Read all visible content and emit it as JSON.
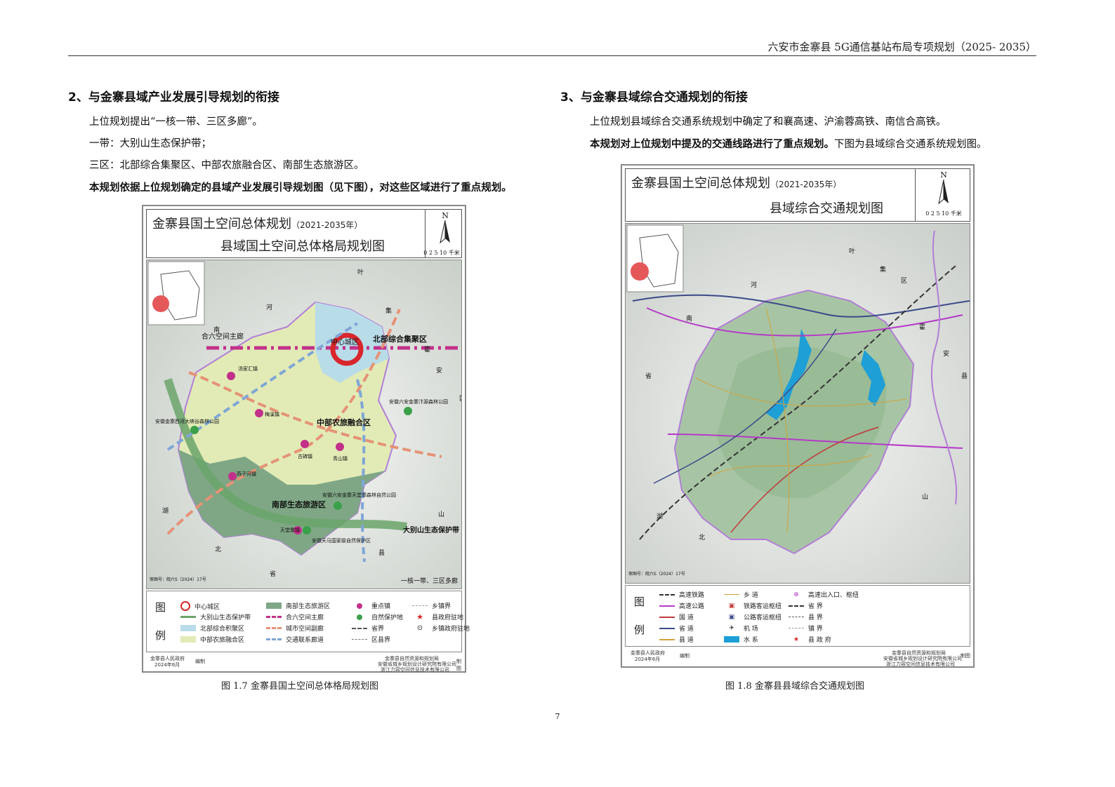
{
  "header": {
    "title": "六安市金寨县 5G通信基站布局专项规划（2025- 2035）"
  },
  "left": {
    "heading": "2、与金寨县域产业发展引导规划的衔接",
    "paras": [
      "上位规划提出“一核一带、三区多廊”。",
      "一带：大别山生态保护带；",
      "三区：北部综合集聚区、中部农旅融合区、南部生态旅游区。",
      "本规划依据上位规划确定的县域产业发展引导规划图（见下图），对这些区域进行了重点规划。"
    ],
    "map": {
      "title1": "金寨县国土空间总体规划",
      "title1_years": "（2021-2035年）",
      "title2": "县域国土空间总体格局规划图",
      "scale": "0 2 5    10",
      "scale_unit": "千米",
      "north": "N",
      "labels": {
        "corridor": "合六空间主廊",
        "center": "中心城区",
        "north_zone": "北部综合集聚区",
        "mid_zone": "中部农旅融合区",
        "south_zone": "南部生态旅游区",
        "belt": "大别山生态保护带",
        "slogan": "一核一带、三区多廊",
        "park1": "安徽金寨西河大峡谷森林公园",
        "park2": "安徽六安金寨汴源森林公园",
        "park3": "安徽六安金寨天堂寨森林自然公园",
        "park4": "安徽天马国家级自然保护区",
        "town1": "汤家汇镇",
        "town2": "梅溪镇",
        "town3": "古碑镇",
        "town4": "青山镇",
        "town5": "燕子河镇",
        "town6": "天堂寨镇",
        "chars": [
          "叶",
          "集",
          "河",
          "南",
          "霍",
          "安",
          "区",
          "湖",
          "北",
          "省",
          "县",
          "山"
        ]
      },
      "legend_key": [
        "图",
        "例"
      ],
      "legend": [
        "中心城区",
        "大别山生态保护带",
        "北部综合积聚区",
        "中部农旅融合区",
        "南部生态旅游区",
        "合六空间主廊",
        "城市空间副廊",
        "交通联系廊道",
        "重点镇",
        "自然保护地",
        "省界",
        "区县界",
        "乡镇界",
        "县政府驻地",
        "乡镇政府驻地"
      ],
      "footer_left": "金寨县人民政府",
      "footer_date": "2024年6月",
      "footer_edit": "编制",
      "footer_org1": "金寨县自然资源和规划局",
      "footer_org2": "安徽省城乡规划设计研究院有限公司",
      "footer_org3": "浙江力容空间信息技术有限公司",
      "footer_draw": "制图",
      "review": "审图号：皖六S（2024）17号"
    },
    "caption": "图 1.7  金寨县国土空间总体格局规划图"
  },
  "right": {
    "heading": "3、与金寨县域综合交通规划的衔接",
    "paras": [
      "上位规划县域综合交通系统规划中确定了和襄高速、沪渝蓉高铁、南信合高铁。"
    ],
    "bold_part": "本规划对上位规划中提及的交通线路进行了重点规划。",
    "normal_part": "下图为县域综合交通系统规划图。",
    "map": {
      "title1": "金寨县国土空间总体规划",
      "title1_years": "（2021-2035年）",
      "title2": "县域综合交通规划图",
      "scale": "0 2 5    10",
      "scale_unit": "千米",
      "north": "N",
      "chars": [
        "叶",
        "集",
        "区",
        "河",
        "南",
        "省",
        "霍",
        "安",
        "县",
        "湖",
        "北",
        "山"
      ],
      "legend_key": [
        "图",
        "例"
      ],
      "legend": [
        "高速铁路",
        "高速公路",
        "国    道",
        "省    道",
        "县    道",
        "乡    道",
        "铁路客运枢纽",
        "公路客运枢纽",
        "机    场",
        "水    系",
        "高速出入口、枢纽",
        "省    界",
        "县    界",
        "镇    界",
        "县 政 府"
      ],
      "footer_left": "金寨县人民政府",
      "footer_date": "2024年6月",
      "footer_edit": "编制",
      "footer_org1": "金寨县自然资源和规划局",
      "footer_org2": "安徽省城乡规划设计研究院有限公司",
      "footer_org3": "浙江力容空间信息技术有限公司",
      "footer_draw": "制图",
      "review": "审图号：皖六S（2024）17号"
    },
    "caption": "图 1.8  金寨县县域综合交通规划图"
  },
  "page_number": "7",
  "colors": {
    "north_zone": "#b9dce9",
    "mid_zone": "#e2ebb6",
    "south_zone": "#7fa786",
    "corridor": "#c2308a",
    "arrow_orange": "#e59276",
    "arrow_blue": "#7fa6d6",
    "belt": "#6aa56a",
    "water": "#1e9fd6"
  }
}
